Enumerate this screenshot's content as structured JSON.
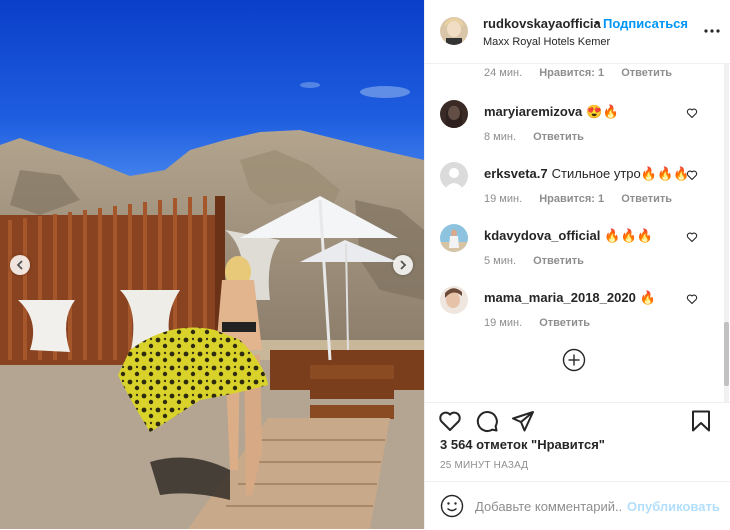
{
  "post": {
    "author": "rudkovskayaofficia",
    "separator": "•",
    "follow_label": "Подписаться",
    "location": "Maxx Royal Hotels Kemer"
  },
  "comments": {
    "top_meta": {
      "time": "24 мин.",
      "likes": "Нравится: 1",
      "reply": "Ответить"
    },
    "items": [
      {
        "user": "maryiaremizova",
        "text": "😍🔥",
        "time": "8 мин.",
        "likes": "",
        "reply": "Ответить"
      },
      {
        "user": "erksveta.7",
        "text": "Стильное утро🔥🔥🔥",
        "time": "19 мин.",
        "likes": "Нравится: 1",
        "reply": "Ответить"
      },
      {
        "user": "kdavydova_official",
        "text": "🔥🔥🔥",
        "time": "5 мин.",
        "likes": "",
        "reply": "Ответить"
      },
      {
        "user": "mama_maria_2018_2020",
        "text": "🔥",
        "time": "19 мин.",
        "likes": "",
        "reply": "Ответить"
      }
    ]
  },
  "stats": {
    "likes_label": "3 564 отметок \"Нравится\"",
    "posted": "25 МИНУТ НАЗАД"
  },
  "composer": {
    "placeholder": "Добавьте комментарий...",
    "publish_label": "Опубликовать"
  },
  "icons": {
    "like": "heart-outline-icon",
    "comment": "speech-bubble-icon",
    "share": "paper-plane-icon",
    "save": "bookmark-icon",
    "more": "ellipsis-icon",
    "emoji": "smiley-icon",
    "load_more": "plus-circle-icon"
  },
  "colors": {
    "link": "#0095f6",
    "muted": "#8e8e8e",
    "publish_disabled": "#b2dffc"
  }
}
